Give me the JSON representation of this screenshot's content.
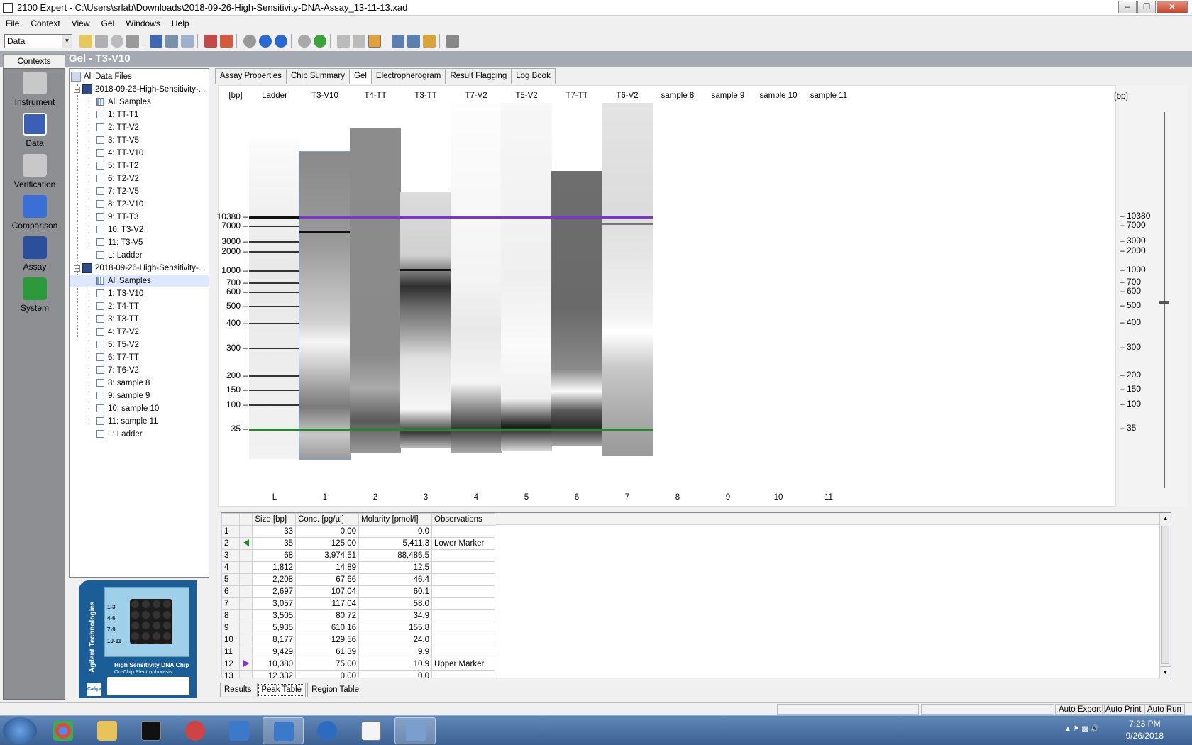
{
  "window": {
    "title": "2100 Expert - C:\\Users\\srlab\\Downloads\\2018-09-26-High-Sensitivity-DNA-Assay_13-11-13.xad"
  },
  "menu": [
    "File",
    "Context",
    "View",
    "Gel",
    "Windows",
    "Help"
  ],
  "toolbar": {
    "context_combo": "Data"
  },
  "contexts": {
    "header": "Contexts",
    "items": [
      {
        "label": "Instrument",
        "icon": "instrument-icon",
        "color": "#c8c8c8"
      },
      {
        "label": "Data",
        "icon": "data-icon",
        "color": "#3a5fb5"
      },
      {
        "label": "Verification",
        "icon": "verification-icon",
        "color": "#c8c8c8"
      },
      {
        "label": "Comparison",
        "icon": "comparison-icon",
        "color": "#3a6fd6"
      },
      {
        "label": "Assay",
        "icon": "assay-icon",
        "color": "#2c4f9c"
      },
      {
        "label": "System",
        "icon": "system-icon",
        "color": "#2a9a3a"
      }
    ]
  },
  "gel_title": "Gel - T3-V10",
  "tree": {
    "root": "All Data Files",
    "files": [
      {
        "name": "2018-09-26-High-Sensitivity-...",
        "all": "All Samples",
        "samples": [
          "1: TT-T1",
          "2: TT-V2",
          "3: TT-V5",
          "4: TT-V10",
          "5: TT-T2",
          "6: T2-V2",
          "7: T2-V5",
          "8: T2-V10",
          "9: TT-T3",
          "10: T3-V2",
          "11: T3-V5",
          "L: Ladder"
        ]
      },
      {
        "name": "2018-09-26-High-Sensitivity-...",
        "all": "All Samples",
        "samples": [
          "1: T3-V10",
          "2: T4-TT",
          "3: T3-TT",
          "4: T7-V2",
          "5: T5-V2",
          "6: T7-TT",
          "7: T6-V2",
          "8: sample 8",
          "9: sample 9",
          "10: sample 10",
          "11: sample 11",
          "L: Ladder"
        ]
      }
    ]
  },
  "chip": {
    "brand": "Agilent Technologies",
    "name": "High Sensitivity DNA Chip",
    "sub": "On-Chip Electrophoresis",
    "rows": [
      "1-3",
      "4-6",
      "7-9",
      "10-11"
    ],
    "maker": "Caliper"
  },
  "tabs": [
    "Assay Properties",
    "Chip Summary",
    "Gel",
    "Electropherogram",
    "Result Flagging",
    "Log Book"
  ],
  "gel": {
    "unit": "[bp]",
    "lanes": [
      {
        "name": "Ladder",
        "num": "L"
      },
      {
        "name": "T3-V10",
        "num": "1"
      },
      {
        "name": "T4-TT",
        "num": "2"
      },
      {
        "name": "T3-TT",
        "num": "3"
      },
      {
        "name": "T7-V2",
        "num": "4"
      },
      {
        "name": "T5-V2",
        "num": "5"
      },
      {
        "name": "T7-TT",
        "num": "6"
      },
      {
        "name": "T6-V2",
        "num": "7"
      },
      {
        "name": "sample 8",
        "num": "8"
      },
      {
        "name": "sample 9",
        "num": "9"
      },
      {
        "name": "sample 10",
        "num": "10"
      },
      {
        "name": "sample 11",
        "num": "11"
      }
    ],
    "bp_ticks": [
      "10380",
      "7000",
      "3000",
      "2000",
      "1000",
      "700",
      "600",
      "500",
      "400",
      "300",
      "200",
      "150",
      "100",
      "35"
    ],
    "upper_marker_color": "#8a2be2",
    "lower_marker_color": "#1f8a2a"
  },
  "peak_table": {
    "headers": [
      "Size [bp]",
      "Conc. [pg/µl]",
      "Molarity [pmol/l]",
      "Observations"
    ],
    "rows": [
      {
        "n": "1",
        "mark": "",
        "size": "33",
        "conc": "0.00",
        "mol": "0.0",
        "obs": ""
      },
      {
        "n": "2",
        "mark": "lower",
        "size": "35",
        "conc": "125.00",
        "mol": "5,411.3",
        "obs": "Lower Marker"
      },
      {
        "n": "3",
        "mark": "",
        "size": "68",
        "conc": "3,974.51",
        "mol": "88,486.5",
        "obs": ""
      },
      {
        "n": "4",
        "mark": "",
        "size": "1,812",
        "conc": "14.89",
        "mol": "12.5",
        "obs": ""
      },
      {
        "n": "5",
        "mark": "",
        "size": "2,208",
        "conc": "67.66",
        "mol": "46.4",
        "obs": ""
      },
      {
        "n": "6",
        "mark": "",
        "size": "2,697",
        "conc": "107.04",
        "mol": "60.1",
        "obs": ""
      },
      {
        "n": "7",
        "mark": "",
        "size": "3,057",
        "conc": "117.04",
        "mol": "58.0",
        "obs": ""
      },
      {
        "n": "8",
        "mark": "",
        "size": "3,505",
        "conc": "80.72",
        "mol": "34.9",
        "obs": ""
      },
      {
        "n": "9",
        "mark": "",
        "size": "5,935",
        "conc": "610.16",
        "mol": "155.8",
        "obs": ""
      },
      {
        "n": "10",
        "mark": "",
        "size": "8,177",
        "conc": "129.56",
        "mol": "24.0",
        "obs": ""
      },
      {
        "n": "11",
        "mark": "",
        "size": "9,429",
        "conc": "61.39",
        "mol": "9.9",
        "obs": ""
      },
      {
        "n": "12",
        "mark": "upper",
        "size": "10,380",
        "conc": "75.00",
        "mol": "10.9",
        "obs": "Upper Marker"
      },
      {
        "n": "13",
        "mark": "",
        "size": "12,332",
        "conc": "0.00",
        "mol": "0.0",
        "obs": ""
      }
    ]
  },
  "bottom_tabs": [
    "Results",
    "Peak Table",
    "Region Table"
  ],
  "status": [
    "Auto Export",
    "Auto Print",
    "Auto Run"
  ],
  "taskbar": {
    "time": "7:23 PM",
    "date": "9/26/2018"
  }
}
